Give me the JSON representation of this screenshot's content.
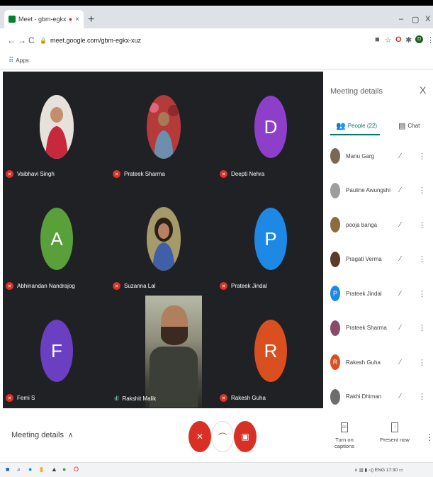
{
  "browser": {
    "tab_title": "Meet - gbm-egkx-xuz",
    "new_tab": "+",
    "url": "meet.google.com/gbm-egkx-xuz",
    "apps_label": "Apps",
    "window_controls": {
      "minimize": "–",
      "maximize": "▢",
      "close": "X"
    }
  },
  "tiles": [
    {
      "name": "Vaibhavi Singh",
      "kind": "photo",
      "color": "#c9c3bd"
    },
    {
      "name": "Prateek Sharma",
      "kind": "photo",
      "color": "#b53a3a"
    },
    {
      "name": "Deepti Nehra",
      "kind": "letter",
      "letter": "D",
      "color": "#8e3fc9"
    },
    {
      "name": "Abhinandan Nandrajog",
      "kind": "letter",
      "letter": "A",
      "color": "#5aa03a"
    },
    {
      "name": "Suzanna Lal",
      "kind": "photo",
      "color": "#8a7b4e"
    },
    {
      "name": "Prateek Jindal",
      "kind": "letter",
      "letter": "P",
      "color": "#1e88e5"
    },
    {
      "name": "Femi S",
      "kind": "letter",
      "letter": "F",
      "color": "#6a3fc2"
    },
    {
      "name": "Rakshit Malik",
      "kind": "video",
      "speaking": true
    },
    {
      "name": "Rakesh Guha",
      "kind": "letter",
      "letter": "R",
      "color": "#d94f1f"
    }
  ],
  "panel": {
    "title": "Meeting details",
    "close": "X",
    "people_tab": "People (22)",
    "chat_tab": "Chat",
    "people": [
      {
        "name": "Manu Garg",
        "color": "#7a6757",
        "letter": ""
      },
      {
        "name": "Pauline Awungshi",
        "color": "#9e9e9e",
        "letter": ""
      },
      {
        "name": "pooja banga",
        "color": "#8c6b3f",
        "letter": ""
      },
      {
        "name": "Pragati Verma",
        "color": "#5a3a2a",
        "letter": ""
      },
      {
        "name": "Prateek Jindal",
        "color": "#1e88e5",
        "letter": "P"
      },
      {
        "name": "Prateek Sharma",
        "color": "#8a4a6a",
        "letter": ""
      },
      {
        "name": "Rakesh Guha",
        "color": "#d94f1f",
        "letter": "R"
      },
      {
        "name": "Rakhi Dhiman",
        "color": "#6d6d6d",
        "letter": ""
      }
    ]
  },
  "bottom": {
    "meeting_details": "Meeting details",
    "captions_label": "Turn on captions",
    "present_label": "Present now"
  },
  "taskbar": {
    "lang": "ENG",
    "time": "17:30"
  },
  "colors": {
    "accent": "#00796b",
    "danger": "#d93025",
    "stage": "#202124"
  }
}
